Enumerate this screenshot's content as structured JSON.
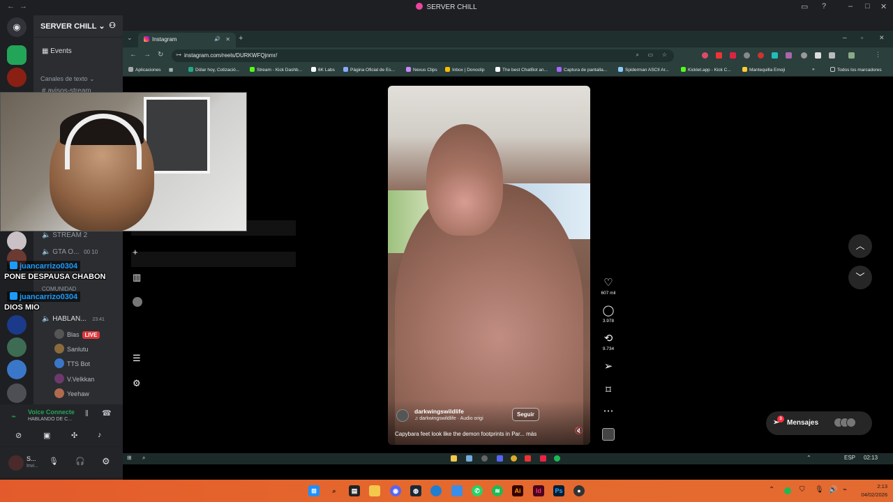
{
  "discord": {
    "window_title": "SERVER CHILL",
    "server_name": "SERVER CHILL",
    "channels": {
      "events": "Events",
      "text_category": "Canales de texto",
      "avisos": "avisos-stream",
      "stream2": "STREAM 2",
      "gta": "GTA O...",
      "gta_counts": "00 10",
      "comunidad": "COMUNIDAD",
      "hablan": "HABLAN...",
      "hablan_time": "23:41"
    },
    "voice_users": [
      {
        "name": "Blas",
        "live": "LIVE"
      },
      {
        "name": "Sanlutu"
      },
      {
        "name": "TTS Bot"
      },
      {
        "name": "V.Velkkan"
      },
      {
        "name": "Yeehaw"
      }
    ],
    "voice_panel": {
      "title": "Voice Connecte",
      "subtitle": "HABLANDO DE C..."
    },
    "user_panel": {
      "name": "S...",
      "status": "Invi..."
    }
  },
  "stream_chat": [
    {
      "user": "juancarrizo0304",
      "message": "PONE DESPAUSA CHABON"
    },
    {
      "user": "juancarrizo0304",
      "message": "DIOS MIO"
    }
  ],
  "browser": {
    "tab_title": "Instagram",
    "url": "instagram.com/reels/DURKWFQjnmr/",
    "bookmarks": [
      "Aplicaciones",
      "Dólar hoy, Cotizació...",
      "Stream - Kick Dashb...",
      "6K Labs",
      "Página Oficial de Es...",
      "Nexus Clips",
      "Inbox | Donoclip",
      "The best ChatBot an...",
      "Captura de pantalla...",
      "Spiderman ASCII Ar...",
      "Kicklet.app - Kick C...",
      "Mantequilla Emoji",
      "Todos los marcadores"
    ]
  },
  "reel": {
    "username": "darkwingswildlife",
    "audio": "darkwingswildlife · Audio origi",
    "follow_label": "Seguir",
    "caption": "Capybara feet look like the demon footprints in Par... más",
    "likes": "607 mil",
    "comments": "3.978",
    "reposts": "9.734"
  },
  "messages": {
    "label": "Mensajes",
    "badge": "3"
  },
  "inner_taskbar": {
    "lang": "ESP",
    "time": "02:13"
  },
  "taskbar": {
    "time": "2:13",
    "date": "04/02/2026"
  },
  "colors": {
    "discord_bg": "#1e1f22",
    "chrome_frame": "#2b3f3c",
    "taskbar_orange": "#e5692d",
    "twitch_blue": "#1a9cff",
    "live_red": "#da373c"
  }
}
